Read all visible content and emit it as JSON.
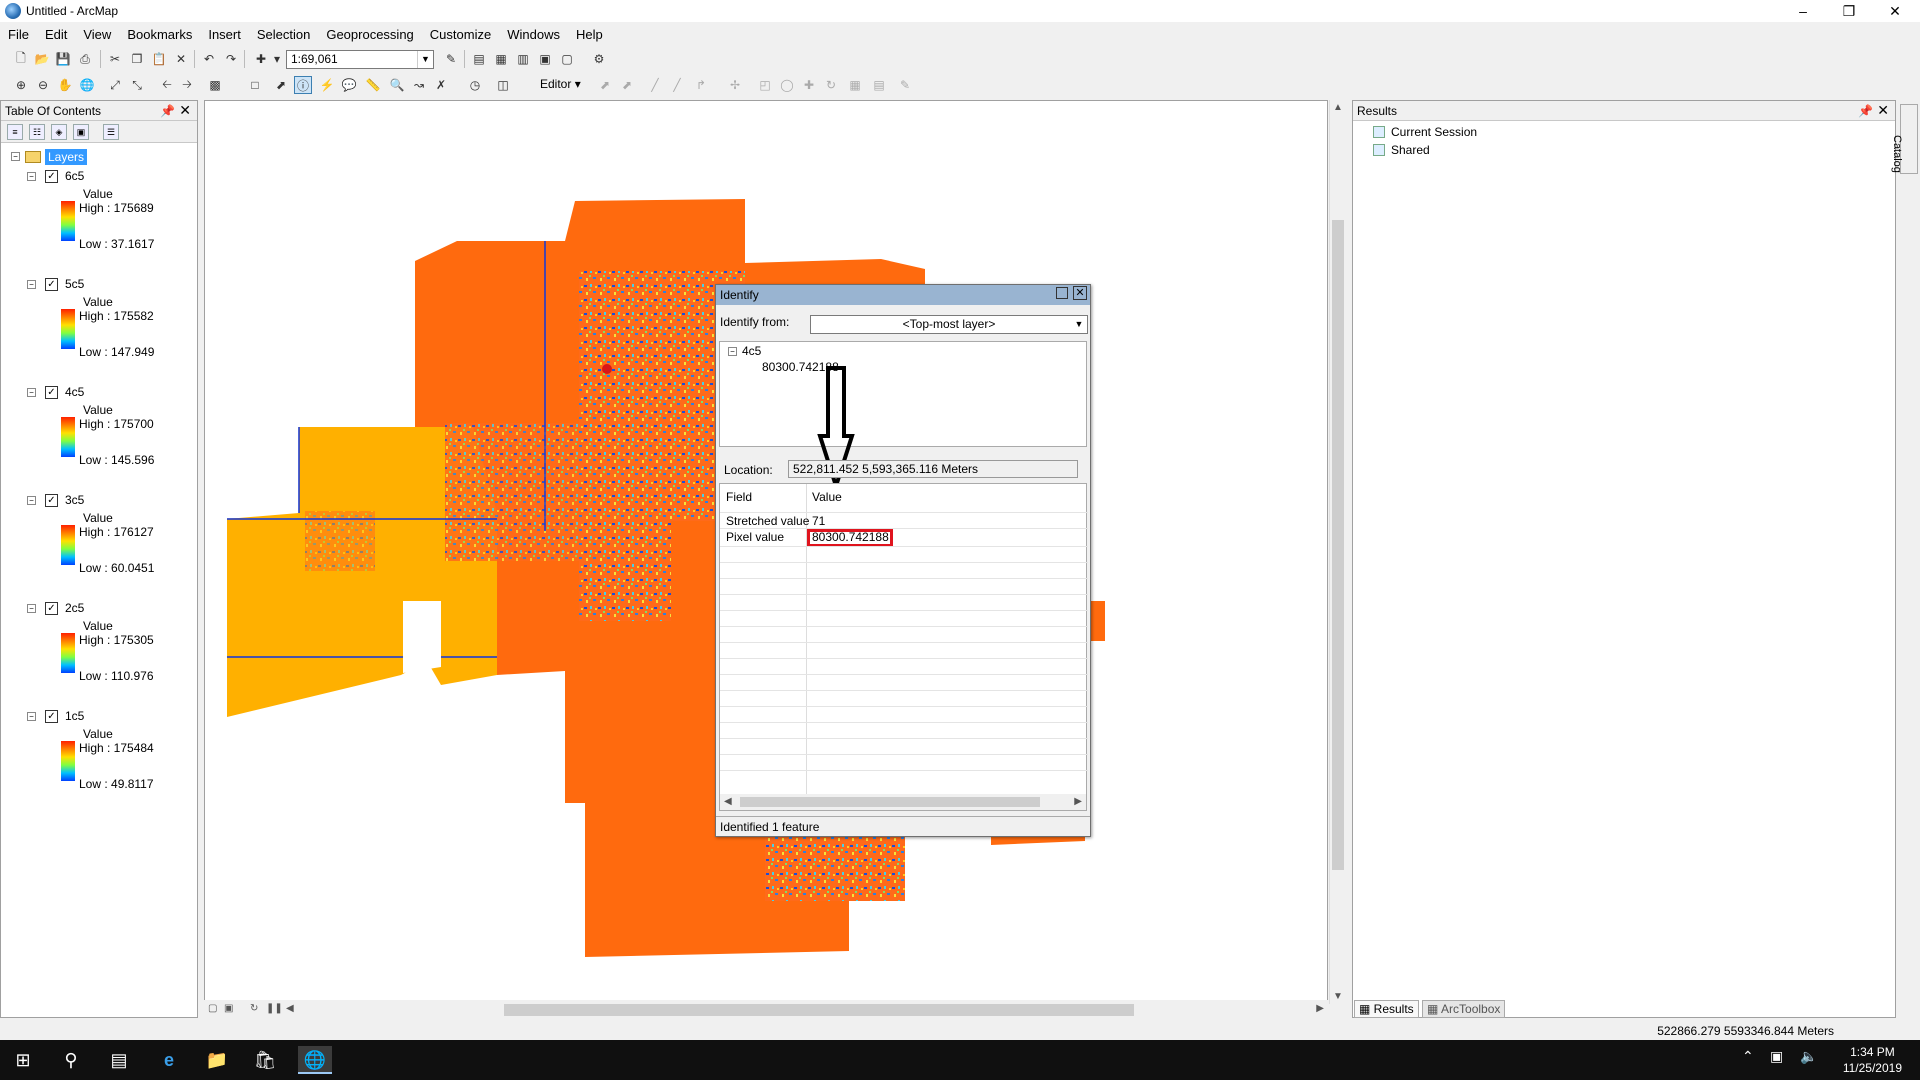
{
  "window": {
    "title": "Untitled - ArcMap"
  },
  "menu": [
    "File",
    "Edit",
    "View",
    "Bookmarks",
    "Insert",
    "Selection",
    "Geoprocessing",
    "Customize",
    "Windows",
    "Help"
  ],
  "toolbar": {
    "scale": "1:69,061",
    "editor_label": "Editor"
  },
  "toc": {
    "title": "Table Of Contents",
    "root_label": "Layers",
    "layers": [
      {
        "name": "6c5",
        "value_label": "Value",
        "high": "High : 175689",
        "low": "Low : 37.1617"
      },
      {
        "name": "5c5",
        "value_label": "Value",
        "high": "High : 175582",
        "low": "Low : 147.949"
      },
      {
        "name": "4c5",
        "value_label": "Value",
        "high": "High : 175700",
        "low": "Low : 145.596"
      },
      {
        "name": "3c5",
        "value_label": "Value",
        "high": "High : 176127",
        "low": "Low : 60.0451"
      },
      {
        "name": "2c5",
        "value_label": "Value",
        "high": "High : 175305",
        "low": "Low : 110.976"
      },
      {
        "name": "1c5",
        "value_label": "Value",
        "high": "High : 175484",
        "low": "Low : 49.8117"
      }
    ]
  },
  "identify": {
    "title": "Identify",
    "from_label": "Identify from:",
    "from_value": "<Top-most layer>",
    "tree_layer": "4c5",
    "tree_value": "80300.742188",
    "location_label": "Location:",
    "location_value": "522,811.452  5,593,365.116 Meters",
    "col_field": "Field",
    "col_value": "Value",
    "rows": [
      {
        "field": "Stretched value",
        "value": "71"
      },
      {
        "field": "Pixel value",
        "value": "80300.742188"
      }
    ],
    "status": "Identified 1 feature"
  },
  "results": {
    "title": "Results",
    "items": [
      "Current Session",
      "Shared"
    ],
    "tabs": [
      "Results",
      "ArcToolbox"
    ]
  },
  "catalog_tab": "Catalog",
  "status": {
    "coords": "522866.279  5593346.844 Meters"
  },
  "clock": {
    "time": "1:34 PM",
    "date": "11/25/2019"
  }
}
